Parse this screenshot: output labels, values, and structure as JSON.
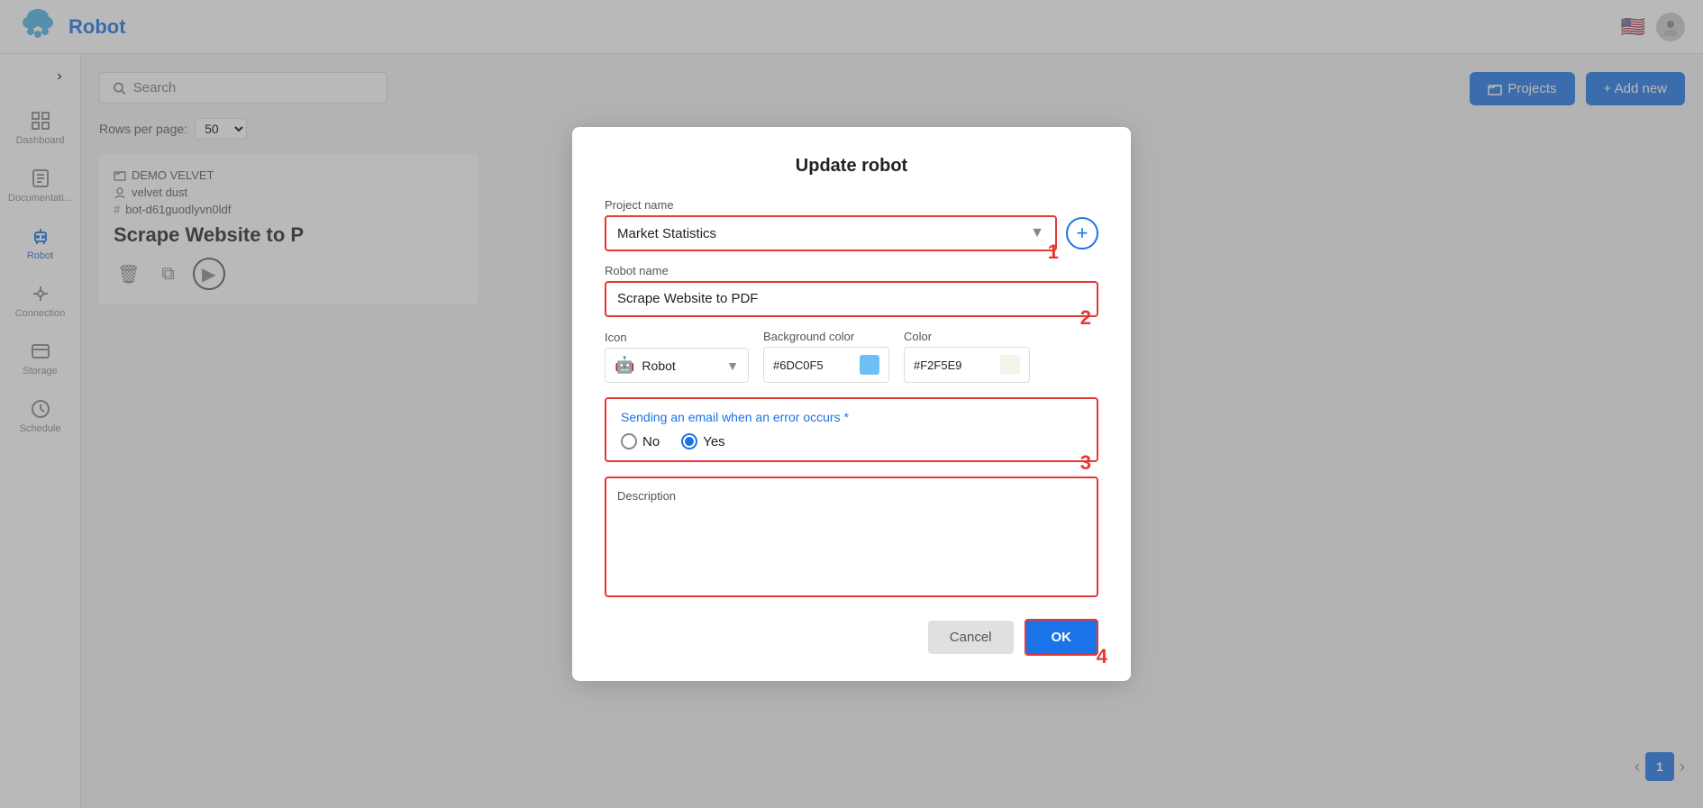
{
  "app": {
    "title": "Robot",
    "logo_alt": "cloud-logo"
  },
  "topbar": {
    "title": "Robot",
    "flag": "🇺🇸",
    "avatar_initial": "👤"
  },
  "sidebar": {
    "toggle_icon": "›",
    "items": [
      {
        "id": "dashboard",
        "label": "Dashboard",
        "active": false
      },
      {
        "id": "documentation",
        "label": "Documentati...",
        "active": false
      },
      {
        "id": "robot",
        "label": "Robot",
        "active": true
      },
      {
        "id": "connection",
        "label": "Connection",
        "active": false
      },
      {
        "id": "storage",
        "label": "Storage",
        "active": false
      },
      {
        "id": "schedule",
        "label": "Schedule",
        "active": false
      }
    ]
  },
  "search": {
    "placeholder": "Search",
    "value": ""
  },
  "rows_per_page": {
    "label": "Rows per page:",
    "value": "50"
  },
  "card": {
    "folder": "DEMO VELVET",
    "user": "velvet dust",
    "hash": "bot-d61guodlyvn0ldf",
    "title": "Scrape Website to P"
  },
  "top_right": {
    "projects_label": "Projects",
    "add_new_label": "+ Add new"
  },
  "pagination": {
    "current": "1"
  },
  "modal": {
    "title": "Update robot",
    "project_name_label": "Project name",
    "project_name_value": "Market Statistics",
    "robot_name_label": "Robot name",
    "robot_name_value": "Scrape Website to PDF",
    "icon_label": "Icon",
    "icon_value": "Robot",
    "bg_color_label": "Background color",
    "bg_color_value": "#6DC0F5",
    "bg_color_swatch": "#6DC0F5",
    "color_label": "Color",
    "color_value": "#F2F5E9",
    "color_swatch": "#F2F5E9",
    "email_error_label": "Sending an email when an error occurs *",
    "radio_no_label": "No",
    "radio_yes_label": "Yes",
    "description_label": "Description",
    "description_value": "",
    "cancel_label": "Cancel",
    "ok_label": "OK",
    "step1": "1",
    "step2": "2",
    "step3": "3",
    "step4": "4"
  }
}
